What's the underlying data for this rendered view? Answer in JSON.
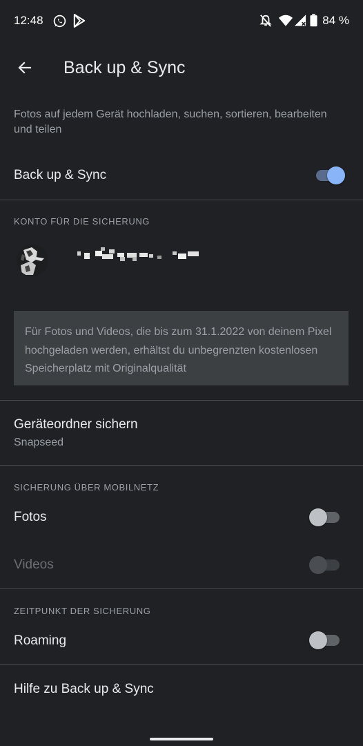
{
  "status_bar": {
    "time": "12:48",
    "battery": "84 %",
    "icons": [
      "whatsapp-icon",
      "play-store-icon",
      "notifications-off-icon",
      "wifi-icon",
      "cell-signal-icon",
      "battery-icon"
    ]
  },
  "header": {
    "title": "Back up & Sync",
    "back_icon": "arrow-back-icon"
  },
  "description": "Fotos auf jedem Gerät hochladen, suchen, sortieren, bearbeiten und teilen",
  "backup_sync": {
    "label": "Back up & Sync",
    "enabled": true
  },
  "account_section": {
    "header": "KONTO FÜR DIE SICHERUNG",
    "info": "Für Fotos und Videos, die bis zum 31.1.2022 von deinem Pixel hochgeladen werden, erhältst du unbegrenzten kostenlosen Speicherplatz mit Originalqualität"
  },
  "device_folders": {
    "label": "Geräteordner sichern",
    "value": "Snapseed"
  },
  "mobile_section": {
    "header": "SICHERUNG ÜBER MOBILNETZ",
    "photos": {
      "label": "Fotos",
      "enabled": false
    },
    "videos": {
      "label": "Videos",
      "enabled": false,
      "disabled": true
    }
  },
  "timing_section": {
    "header": "ZEITPUNKT DER SICHERUNG",
    "roaming": {
      "label": "Roaming",
      "enabled": false
    }
  },
  "help": {
    "label": "Hilfe zu Back up & Sync"
  },
  "colors": {
    "background": "#202124",
    "accent": "#8ab4f8",
    "info_box": "#3c4043"
  }
}
